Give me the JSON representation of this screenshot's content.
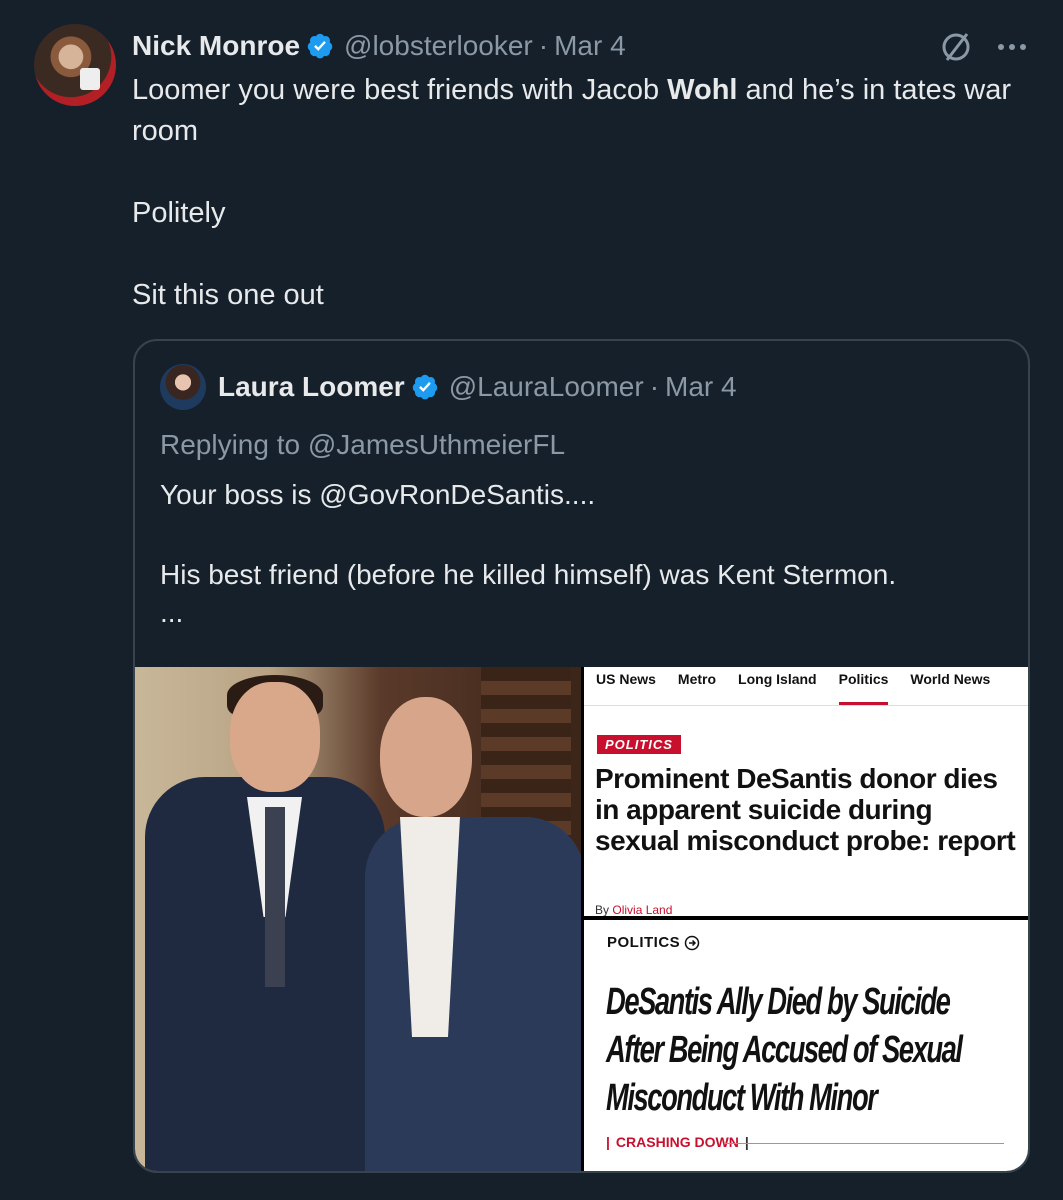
{
  "tweet": {
    "author_name": "Nick Monroe",
    "handle": "@lobsterlooker",
    "separator": "·",
    "date": "Mar 4",
    "text_part1": "Loomer you were best friends with Jacob ",
    "text_bold": "Wohl",
    "text_part2": " and he’s in tates war room",
    "line2": "Politely",
    "line3": "Sit this one out"
  },
  "quoted": {
    "author_name": "Laura Loomer",
    "handle": "@LauraLoomer",
    "separator": "·",
    "date": "Mar 4",
    "replying_to": "Replying to @JamesUthmeierFL",
    "line1": "Your boss is @GovRonDeSantis....",
    "line2": "His best friend (before he killed himself) was Kent Stermon.",
    "ellipsis": "..."
  },
  "news1": {
    "nav": [
      "US News",
      "Metro",
      "Long Island",
      "Politics",
      "World News"
    ],
    "active_nav": "Politics",
    "tag": "POLITICS",
    "headline": "Prominent DeSantis donor dies in apparent suicide during sexual misconduct probe: report",
    "byline_prefix": "By",
    "byline_author": "Olivia Land"
  },
  "news2": {
    "section": "POLITICS",
    "headline": "DeSantis Ally Died by Suicide After Being Accused of Sexual Misconduct With Minor",
    "kicker": "CRASHING DOWN"
  },
  "colors": {
    "background": "#15202b",
    "verified": "#1d9bf0",
    "accent_red": "#c8102e"
  },
  "icons": [
    "verified-badge-icon",
    "grok-slash-icon",
    "more-options-icon",
    "arrow-circle-icon"
  ]
}
